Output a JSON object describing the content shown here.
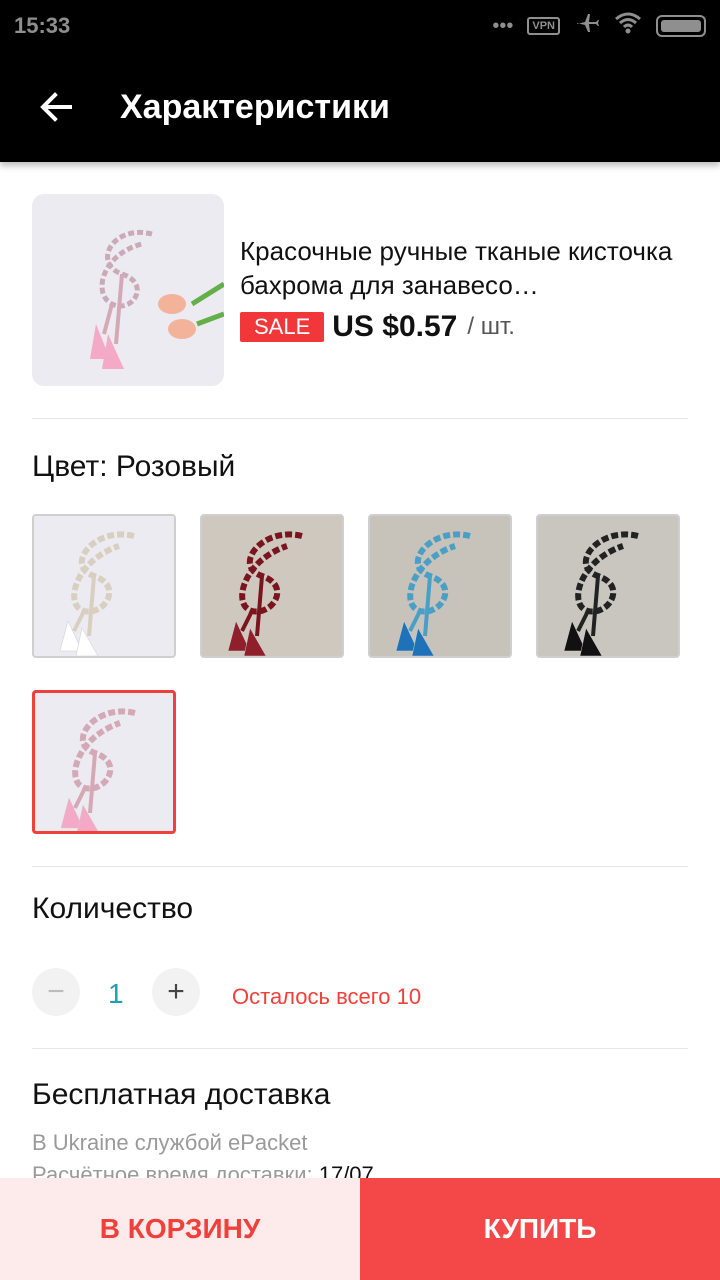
{
  "status_bar": {
    "time": "15:33",
    "vpn": "VPN",
    "icons": [
      "more-dots-icon",
      "vpn-icon",
      "airplane-icon",
      "wifi-icon",
      "battery-icon"
    ]
  },
  "app_bar": {
    "title": "Характеристики",
    "back_icon": "arrow-left-icon"
  },
  "product": {
    "title": "Красочные ручные тканые кисточка бахрома для занавесо…",
    "sale_label": "SALE",
    "price": "US $0.57",
    "unit": "/ шт."
  },
  "color": {
    "label": "Цвет: Розовый",
    "options": [
      {
        "name": "white",
        "tassel": "#ffffff",
        "rope": "#d8cfc0",
        "bg": "#ecebf1"
      },
      {
        "name": "wine",
        "tassel": "#8f1f2a",
        "rope": "#7a1520",
        "bg": "#cfc8bf"
      },
      {
        "name": "blue",
        "tassel": "#1e72b8",
        "rope": "#4a9fc6",
        "bg": "#c7c3bb"
      },
      {
        "name": "black",
        "tassel": "#111111",
        "rope": "#222222",
        "bg": "#c9c6bf"
      },
      {
        "name": "pink",
        "tassel": "#f4a9c6",
        "rope": "#d4a9b5",
        "bg": "#ecebf1"
      }
    ],
    "selected_index": 4
  },
  "quantity": {
    "label": "Количество",
    "value": "1",
    "minus": "−",
    "plus": "+",
    "stock_note": "Осталось всего 10"
  },
  "shipping": {
    "title": "Бесплатная доставка",
    "line1": "В Ukraine службой ePacket",
    "line2_prefix": "Расчётное время доставки: ",
    "line2_date": "17/07"
  },
  "actions": {
    "cart": "В КОРЗИНУ",
    "buy": "КУПИТЬ"
  },
  "colors": {
    "accent": "#f0403c",
    "buy_bg": "#f44848",
    "cart_bg": "#fdeaea",
    "qty_value": "#1e9fb3"
  }
}
